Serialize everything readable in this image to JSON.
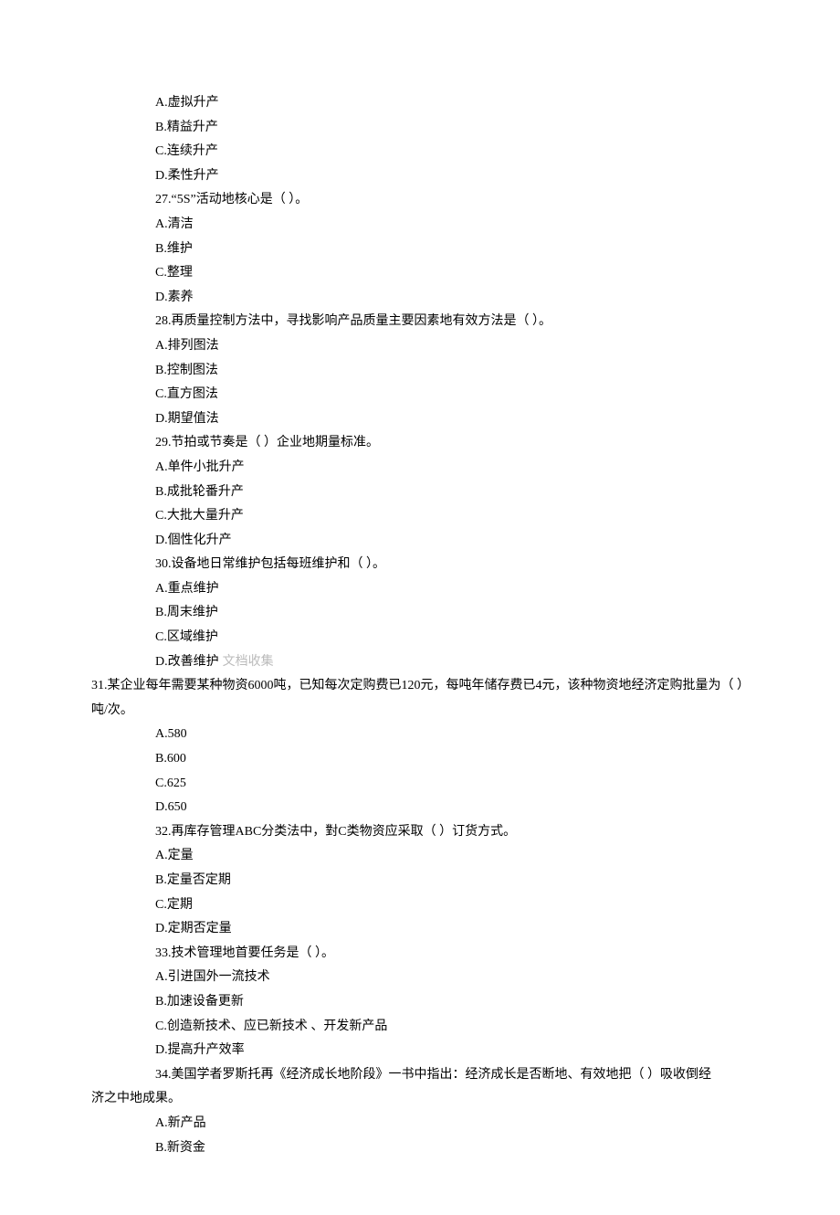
{
  "lines": [
    {
      "indent": true,
      "text": "A.虚拟升产"
    },
    {
      "indent": true,
      "text": "B.精益升产"
    },
    {
      "indent": true,
      "text": "C.连续升产"
    },
    {
      "indent": true,
      "text": "D.柔性升产"
    },
    {
      "indent": true,
      "text": "27.“5S”活动地核心是（ ）。"
    },
    {
      "indent": true,
      "text": "A.清洁"
    },
    {
      "indent": true,
      "text": "B.维护"
    },
    {
      "indent": true,
      "text": "C.整理"
    },
    {
      "indent": true,
      "text": "D.素养"
    },
    {
      "indent": true,
      "text": "28.再质量控制方法中，寻找影响产品质量主要因素地有效方法是（ ）。"
    },
    {
      "indent": true,
      "text": "A.排列图法"
    },
    {
      "indent": true,
      "text": "B.控制图法"
    },
    {
      "indent": true,
      "text": "C.直方图法"
    },
    {
      "indent": true,
      "text": "D.期望值法"
    },
    {
      "indent": true,
      "text": "29.节拍或节奏是（ ）企业地期量标准。"
    },
    {
      "indent": true,
      "text": "A.单件小批升产"
    },
    {
      "indent": true,
      "text": "B.成批轮番升产"
    },
    {
      "indent": true,
      "text": "C.大批大量升产"
    },
    {
      "indent": true,
      "text": "D.個性化升产"
    },
    {
      "indent": true,
      "text": "30.设备地日常维护包括每班维护和（ ）。"
    },
    {
      "indent": true,
      "text": "A.重点维护"
    },
    {
      "indent": true,
      "text": "B.周末维护"
    },
    {
      "indent": true,
      "text": "C.区域维护"
    },
    {
      "indent": true,
      "text": "D.改善维护",
      "watermark": "文档收集"
    },
    {
      "indent": false,
      "text": "31.某企业每年需要某种物资6000吨，已知每次定购费已120元，每吨年储存费已4元，该种物资地经济定购批量为（ ）吨/次。"
    },
    {
      "indent": true,
      "text": "A.580"
    },
    {
      "indent": true,
      "text": "B.600"
    },
    {
      "indent": true,
      "text": "C.625"
    },
    {
      "indent": true,
      "text": "D.650"
    },
    {
      "indent": true,
      "text": "32.再库存管理ABC分类法中，對C类物资应采取（ ）订货方式。"
    },
    {
      "indent": true,
      "text": "A.定量"
    },
    {
      "indent": true,
      "text": "B.定量否定期"
    },
    {
      "indent": true,
      "text": "C.定期"
    },
    {
      "indent": true,
      "text": "D.定期否定量"
    },
    {
      "indent": true,
      "text": "33.技术管理地首要任务是（ ）。"
    },
    {
      "indent": true,
      "text": "A.引进国外一流技术"
    },
    {
      "indent": true,
      "text": "B.加速设备更新"
    },
    {
      "indent": true,
      "text": "C.创造新技术、应已新技术 、开发新产品"
    },
    {
      "indent": true,
      "text": "D.提高升产效率"
    },
    {
      "indent": true,
      "text": "34.美国学者罗斯托再《经济成长地阶段》一书中指出：经济成长是否断地、有效地把（ ）吸收倒经",
      "continuation": "济之中地成果。"
    },
    {
      "indent": true,
      "text": "A.新产品"
    },
    {
      "indent": true,
      "text": "B.新资金"
    }
  ]
}
